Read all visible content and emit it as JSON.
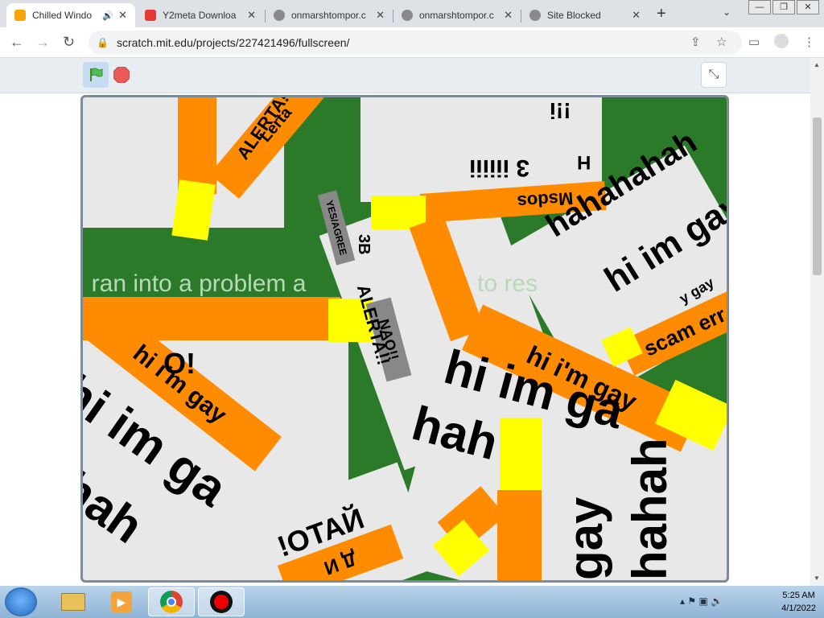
{
  "browser": {
    "tabs": [
      {
        "label": "Chilled Windo",
        "color": "#f7a300",
        "active": true
      },
      {
        "label": "Y2meta Downloa",
        "color": "#e53935"
      },
      {
        "label": "onmarshtompor.c",
        "color": "#8a8a8a"
      },
      {
        "label": "onmarshtompor.c",
        "color": "#8a8a8a"
      },
      {
        "label": "Site Blocked",
        "color": "#8a8a8a"
      }
    ],
    "tab_close": "✕",
    "new_tab": "+",
    "tab_dropdown": "⌄",
    "url": "scratch.mit.edu/projects/227421496/fullscreen/",
    "nav": {
      "back": "←",
      "forward": "→",
      "reload": "↻"
    },
    "window_controls": {
      "minimize": "—",
      "restore": "❐",
      "close": "✕"
    },
    "omnibox_icons": {
      "share": "⇪",
      "bookmark": "☆",
      "sidepanel": "▭",
      "profile": "●",
      "menu": "⋮"
    }
  },
  "scratch": {
    "green_flag_icon": "green-flag-icon",
    "stop_icon": "stop-icon",
    "fullscreen_exit": "⤡",
    "colors": {
      "stage_bg": "#2a7a2a",
      "orange": "#ff8c00",
      "yellow": "#ffff00",
      "card": "#e8e8e8",
      "tag": "#888888"
    }
  },
  "stage": {
    "error_text": "I ran into a problem a",
    "error_text2": "to res",
    "texts": {
      "t1": "hi i'm gay",
      "t2": "hi i'm gay",
      "t3": "hi im ga",
      "t4": "hi im ga",
      "t5": "hahahahah",
      "t6": "hi im gay",
      "t7": "hah",
      "t8": "gay",
      "t9": "hahah",
      "t10": "Msdos",
      "t11": "3 iiiiii",
      "t12": "ALERTA!!",
      "t13": "ALERTA!!",
      "t14": "YES/AGREE",
      "t15": "NAO!!",
      "t16": "!OTAЙ",
      "t17": "Д И",
      "t18": "3B",
      "t19": "scam err",
      "t20": "y gay",
      "t21": "Lerta",
      "t22": "H",
      "t23": "hah",
      "t24": "!!i",
      "t25": "O!"
    }
  },
  "taskbar": {
    "time": "5:25 AM",
    "date": "4/1/2022",
    "tray_icons": "▴ ⚑ ▣ 🔊"
  }
}
